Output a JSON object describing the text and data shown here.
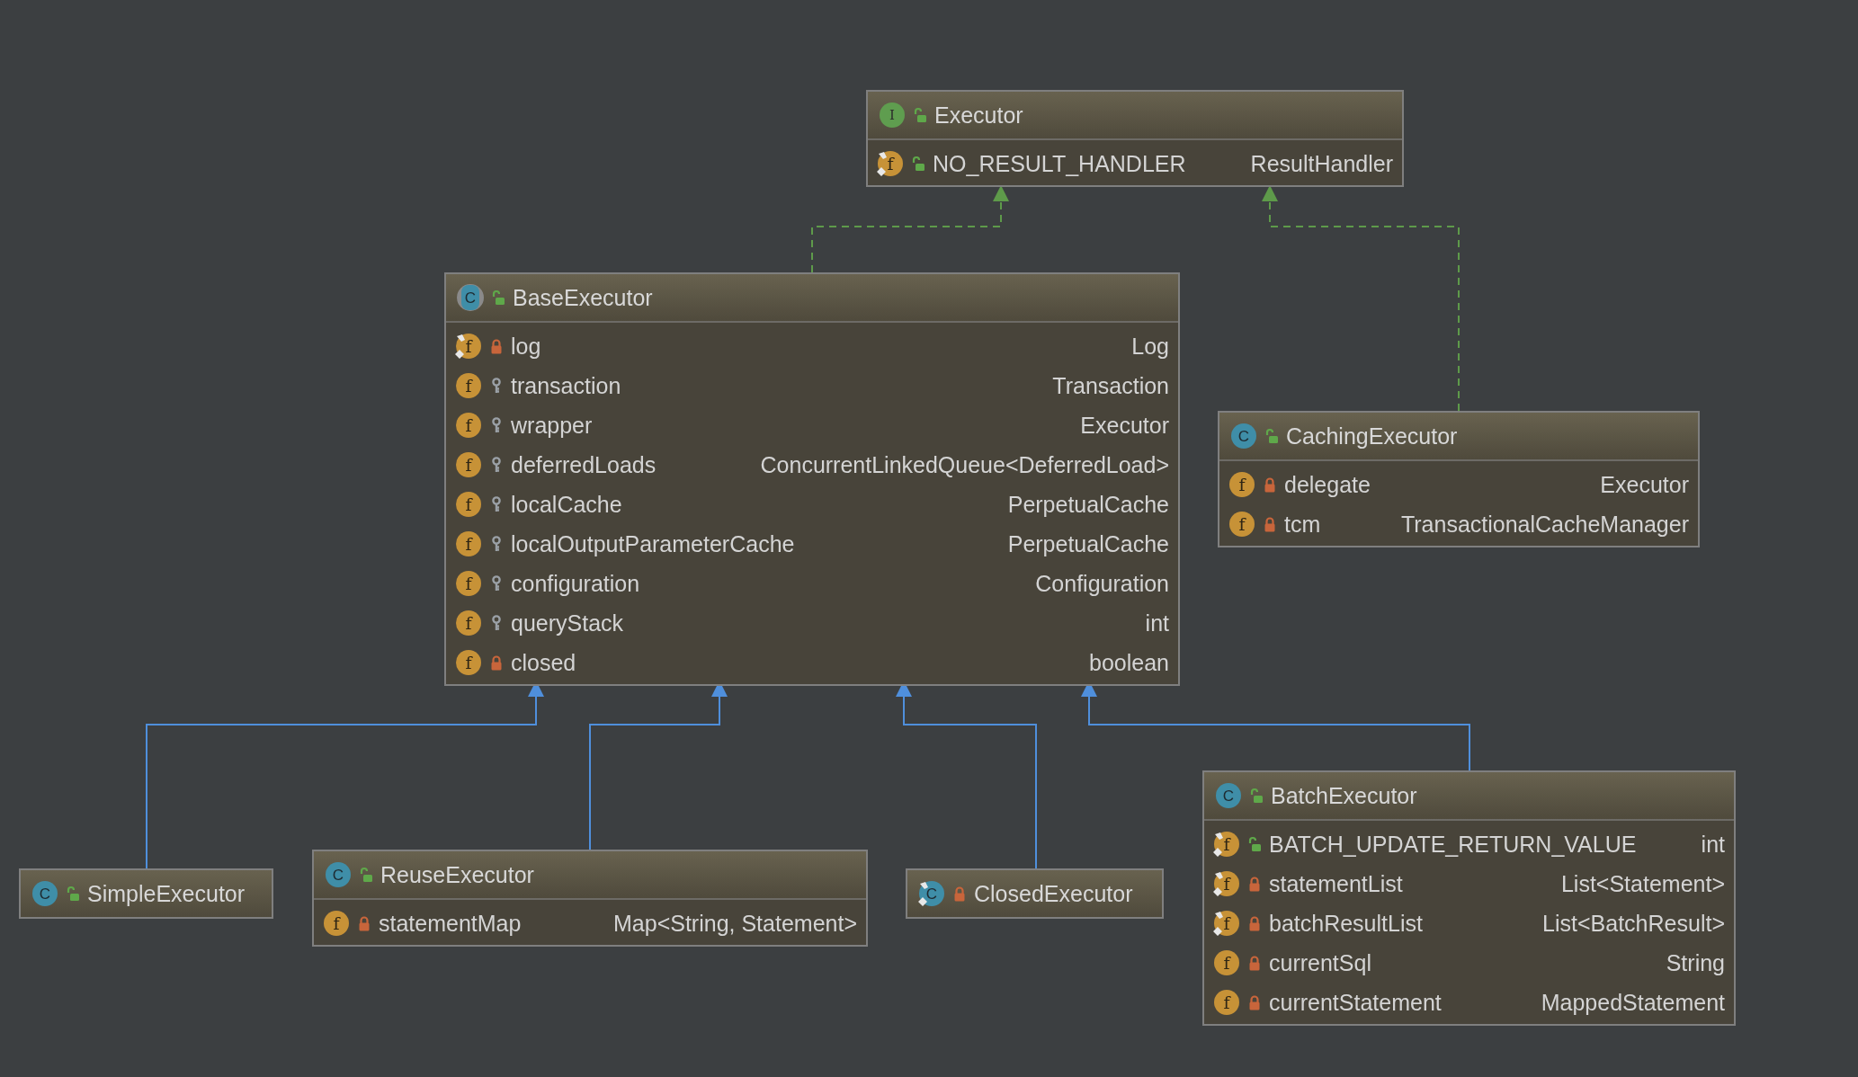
{
  "classes": [
    {
      "kind": "interface",
      "badge": "I",
      "name": "Executor",
      "private": false,
      "static": false,
      "fields": [
        {
          "badge": "f",
          "name": "NO_RESULT_HANDLER",
          "type": "ResultHandler",
          "kind": "public",
          "static": true
        }
      ]
    },
    {
      "kind": "abstract",
      "badge": "C",
      "name": "BaseExecutor",
      "private": false,
      "static": false,
      "fields": [
        {
          "badge": "f",
          "name": "log",
          "type": "Log",
          "kind": "private",
          "static": true
        },
        {
          "badge": "f",
          "name": "transaction",
          "type": "Transaction",
          "kind": "protected",
          "static": false
        },
        {
          "badge": "f",
          "name": "wrapper",
          "type": "Executor",
          "kind": "protected",
          "static": false
        },
        {
          "badge": "f",
          "name": "deferredLoads",
          "type": "ConcurrentLinkedQueue<DeferredLoad>",
          "kind": "protected",
          "static": false
        },
        {
          "badge": "f",
          "name": "localCache",
          "type": "PerpetualCache",
          "kind": "protected",
          "static": false
        },
        {
          "badge": "f",
          "name": "localOutputParameterCache",
          "type": "PerpetualCache",
          "kind": "protected",
          "static": false
        },
        {
          "badge": "f",
          "name": "configuration",
          "type": "Configuration",
          "kind": "protected",
          "static": false
        },
        {
          "badge": "f",
          "name": "queryStack",
          "type": "int",
          "kind": "protected",
          "static": false
        },
        {
          "badge": "f",
          "name": "closed",
          "type": "boolean",
          "kind": "private",
          "static": false
        }
      ]
    },
    {
      "kind": "class",
      "badge": "C",
      "name": "CachingExecutor",
      "private": false,
      "static": false,
      "fields": [
        {
          "badge": "f",
          "name": "delegate",
          "type": "Executor",
          "kind": "private",
          "static": false
        },
        {
          "badge": "f",
          "name": "tcm",
          "type": "TransactionalCacheManager",
          "kind": "private",
          "static": false
        }
      ]
    },
    {
      "kind": "class",
      "badge": "C",
      "name": "SimpleExecutor",
      "private": false,
      "static": false
    },
    {
      "kind": "class",
      "badge": "C",
      "name": "ReuseExecutor",
      "private": false,
      "static": false,
      "fields": [
        {
          "badge": "f",
          "name": "statementMap",
          "type": "Map<String, Statement>",
          "kind": "private",
          "static": false
        }
      ]
    },
    {
      "kind": "class",
      "badge": "C",
      "name": "ClosedExecutor",
      "private": true,
      "static": true
    },
    {
      "kind": "class",
      "badge": "C",
      "name": "BatchExecutor",
      "private": false,
      "static": false,
      "fields": [
        {
          "badge": "f",
          "name": "BATCH_UPDATE_RETURN_VALUE",
          "type": "int",
          "kind": "public",
          "static": true
        },
        {
          "badge": "f",
          "name": "statementList",
          "type": "List<Statement>",
          "kind": "private",
          "static": true
        },
        {
          "badge": "f",
          "name": "batchResultList",
          "type": "List<BatchResult>",
          "kind": "private",
          "static": true
        },
        {
          "badge": "f",
          "name": "currentSql",
          "type": "String",
          "kind": "private",
          "static": false
        },
        {
          "badge": "f",
          "name": "currentStatement",
          "type": "MappedStatement",
          "kind": "private",
          "static": false
        }
      ]
    }
  ],
  "edges": [
    {
      "kind": "implements"
    },
    {
      "kind": "implements"
    },
    {
      "kind": "extends"
    },
    {
      "kind": "extends"
    },
    {
      "kind": "extends"
    },
    {
      "kind": "extends"
    }
  ]
}
